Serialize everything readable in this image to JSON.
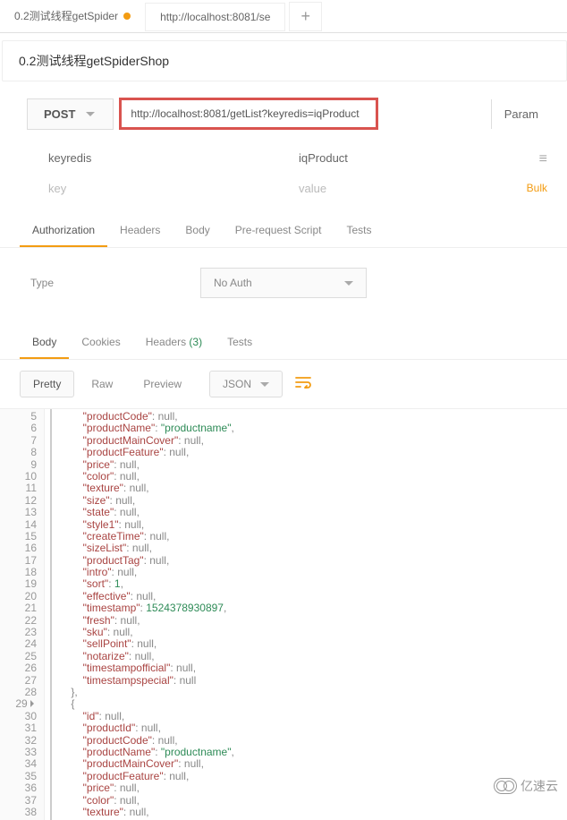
{
  "topTabs": {
    "active": "0.2测试线程getSpider",
    "inactive": "http://localhost:8081/se",
    "add": "+"
  },
  "title": "0.2测试线程getSpiderShop",
  "method": "POST",
  "url": "http://localhost:8081/getList?keyredis=iqProduct",
  "paramsBtn": "Param",
  "params": {
    "key": "keyredis",
    "value": "iqProduct",
    "keyPlaceholder": "key",
    "valuePlaceholder": "value",
    "bulkEdit": "Bulk"
  },
  "reqTabs": [
    "Authorization",
    "Headers",
    "Body",
    "Pre-request Script",
    "Tests"
  ],
  "auth": {
    "label": "Type",
    "value": "No Auth"
  },
  "respTabs": {
    "body": "Body",
    "cookies": "Cookies",
    "headers": "Headers",
    "headersCount": "(3)",
    "tests": "Tests"
  },
  "bodyToolbar": {
    "pretty": "Pretty",
    "raw": "Raw",
    "preview": "Preview",
    "format": "JSON"
  },
  "codeStart": 5,
  "code": [
    [
      2,
      [
        "productCode",
        ": ",
        "null",
        ","
      ]
    ],
    [
      2,
      [
        "productName",
        ": ",
        "\"productname\"",
        ","
      ]
    ],
    [
      2,
      [
        "productMainCover",
        ": ",
        "null",
        ","
      ]
    ],
    [
      2,
      [
        "productFeature",
        ": ",
        "null",
        ","
      ]
    ],
    [
      2,
      [
        "price",
        ": ",
        "null",
        ","
      ]
    ],
    [
      2,
      [
        "color",
        ": ",
        "null",
        ","
      ]
    ],
    [
      2,
      [
        "texture",
        ": ",
        "null",
        ","
      ]
    ],
    [
      2,
      [
        "size",
        ": ",
        "null",
        ","
      ]
    ],
    [
      2,
      [
        "state",
        ": ",
        "null",
        ","
      ]
    ],
    [
      2,
      [
        "style1",
        ": ",
        "null",
        ","
      ]
    ],
    [
      2,
      [
        "createTime",
        ": ",
        "null",
        ","
      ]
    ],
    [
      2,
      [
        "sizeList",
        ": ",
        "null",
        ","
      ]
    ],
    [
      2,
      [
        "productTag",
        ": ",
        "null",
        ","
      ]
    ],
    [
      2,
      [
        "intro",
        ": ",
        "null",
        ","
      ]
    ],
    [
      2,
      [
        "sort",
        ": ",
        "1",
        ","
      ]
    ],
    [
      2,
      [
        "effective",
        ": ",
        "null",
        ","
      ]
    ],
    [
      2,
      [
        "timestamp",
        ": ",
        "1524378930897",
        ","
      ]
    ],
    [
      2,
      [
        "fresh",
        ": ",
        "null",
        ","
      ]
    ],
    [
      2,
      [
        "sku",
        ": ",
        "null",
        ","
      ]
    ],
    [
      2,
      [
        "sellPoint",
        ": ",
        "null",
        ","
      ]
    ],
    [
      2,
      [
        "notarize",
        ": ",
        "null",
        ","
      ]
    ],
    [
      2,
      [
        "timestampofficial",
        ": ",
        "null",
        ","
      ]
    ],
    [
      2,
      [
        "timestampspecial",
        ": ",
        "null",
        ""
      ]
    ],
    [
      1,
      [
        "},"
      ]
    ],
    [
      1,
      [
        "{"
      ]
    ],
    [
      2,
      [
        "id",
        ": ",
        "null",
        ","
      ]
    ],
    [
      2,
      [
        "productId",
        ": ",
        "null",
        ","
      ]
    ],
    [
      2,
      [
        "productCode",
        ": ",
        "null",
        ","
      ]
    ],
    [
      2,
      [
        "productName",
        ": ",
        "\"productname\"",
        ","
      ]
    ],
    [
      2,
      [
        "productMainCover",
        ": ",
        "null",
        ","
      ]
    ],
    [
      2,
      [
        "productFeature",
        ": ",
        "null",
        ","
      ]
    ],
    [
      2,
      [
        "price",
        ": ",
        "null",
        ","
      ]
    ],
    [
      2,
      [
        "color",
        ": ",
        "null",
        ","
      ]
    ],
    [
      2,
      [
        "texture",
        ": ",
        "null",
        ","
      ]
    ]
  ],
  "watermark": "亿速云"
}
